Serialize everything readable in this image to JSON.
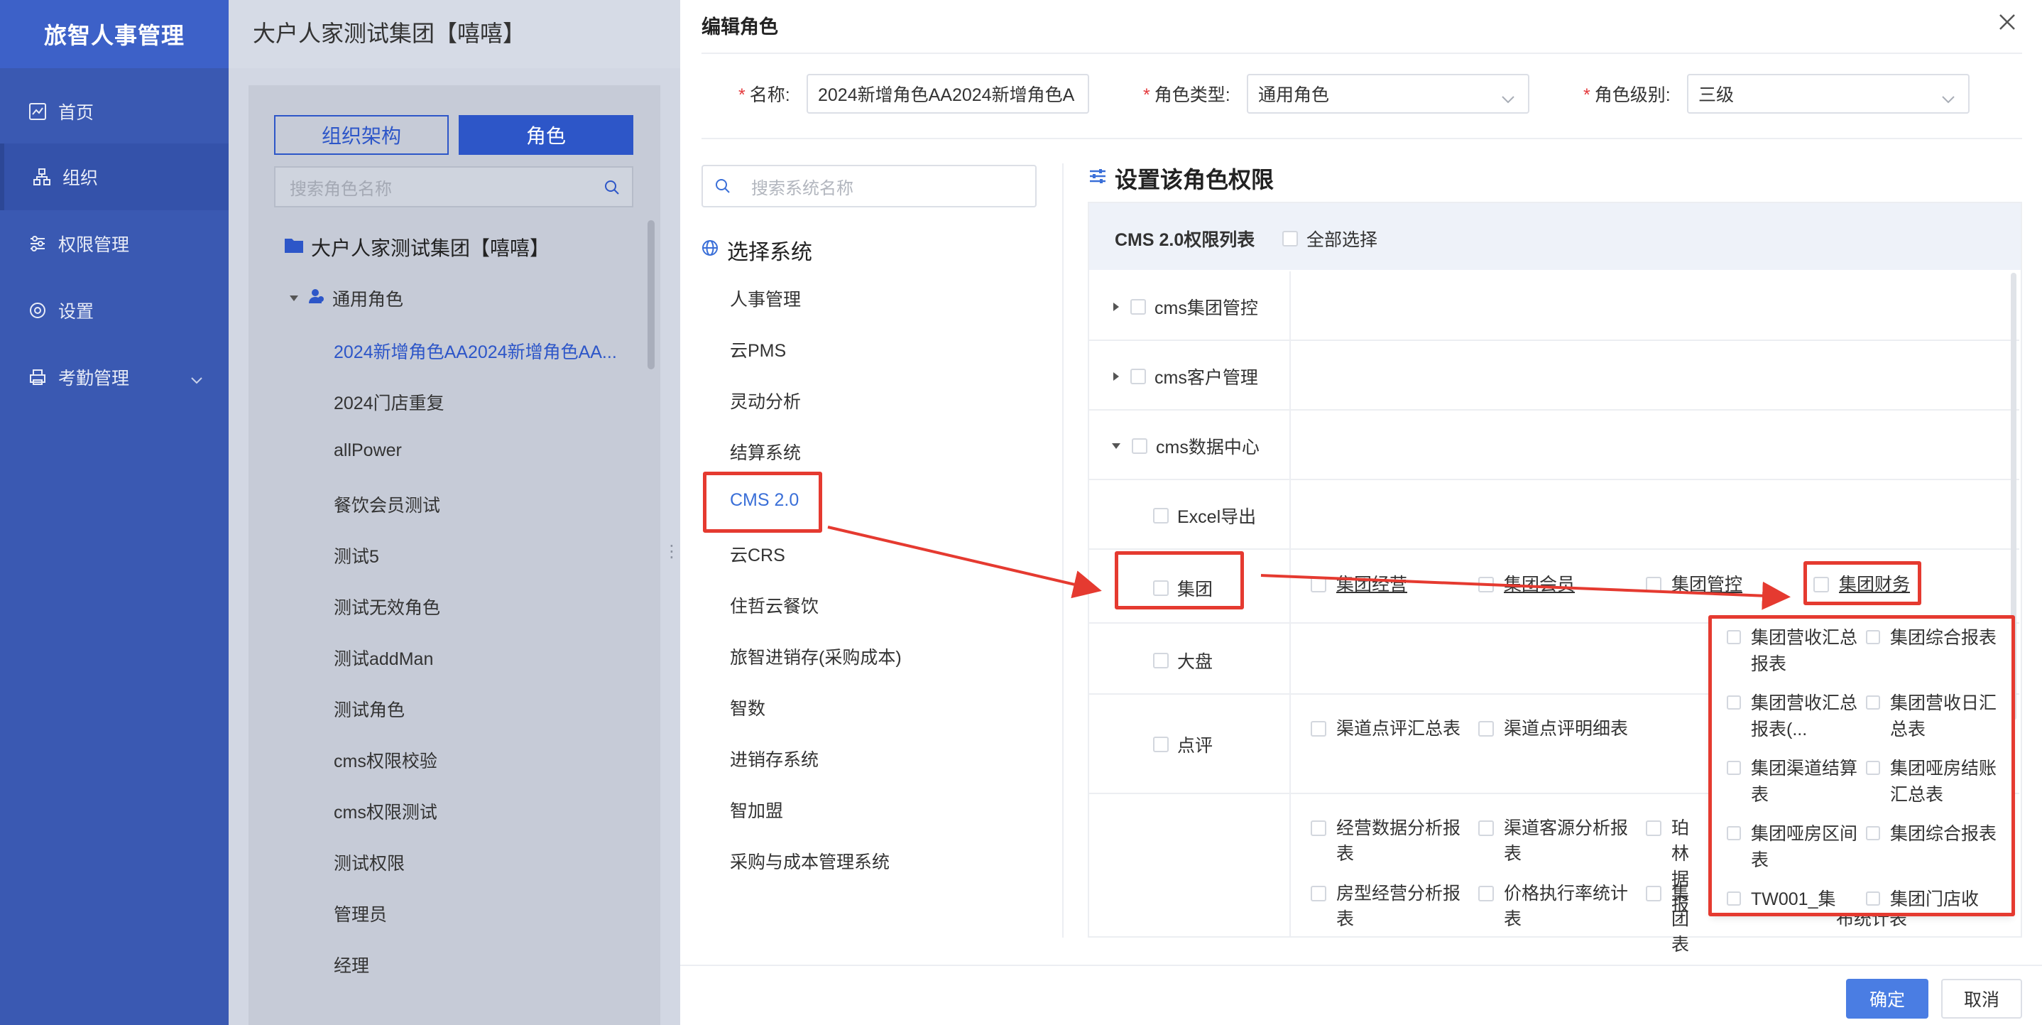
{
  "sidebar": {
    "brand": "旅智人事管理",
    "items": [
      {
        "label": "首页",
        "icon": "chart-icon"
      },
      {
        "label": "组织",
        "icon": "org-icon"
      },
      {
        "label": "权限管理",
        "icon": "sliders-icon"
      },
      {
        "label": "设置",
        "icon": "gear-icon"
      },
      {
        "label": "考勤管理",
        "icon": "printer-icon"
      }
    ]
  },
  "org": {
    "title": "大户人家测试集团【嘻嘻】",
    "tab_org": "组织架构",
    "tab_role": "角色",
    "search_placeholder": "搜索角色名称",
    "tree_root": "大户人家测试集团【嘻嘻】",
    "tree_group": "通用角色",
    "roles": [
      "2024新增角色AA2024新增角色AA...",
      "2024门店重复",
      "allPower",
      "餐饮会员测试",
      "测试5",
      "测试无效角色",
      "测试addMan",
      "测试角色",
      "cms权限校验",
      "cms权限测试",
      "测试权限",
      "管理员",
      "经理"
    ]
  },
  "modal": {
    "title": "编辑角色",
    "name_label": "名称:",
    "name_value": "2024新增角色AA2024新增角色A",
    "type_label": "角色类型:",
    "type_value": "通用角色",
    "level_label": "角色级别:",
    "level_value": "三级",
    "sys_search_placeholder": "搜索系统名称",
    "sys_heading": "选择系统",
    "systems": [
      "人事管理",
      "云PMS",
      "灵动分析",
      "结算系统",
      "CMS 2.0",
      "云CRS",
      "住哲云餐饮",
      "旅智进销存(采购成本)",
      "智数",
      "进销存系统",
      "智加盟",
      "采购与成本管理系统"
    ],
    "perm_heading": "设置该角色权限",
    "perm_list_title": "CMS 2.0权限列表",
    "select_all": "全部选择",
    "perm_rows": {
      "r1": "cms集团管控",
      "r2": "cms客户管理",
      "r3": "cms数据中心",
      "r4": "Excel导出",
      "r5": "集团",
      "r6": "大盘",
      "r7": "点评"
    },
    "group_subs": [
      "集团经营",
      "集团会员",
      "集团管控",
      "集团财务"
    ],
    "review_subs": [
      "渠道点评汇总表",
      "渠道点评明细表"
    ],
    "more_subs": [
      "经营数据分析报表",
      "渠道客源分析报表",
      "珀林据报",
      "房型经营分析报表",
      "价格执行率统计表",
      "集团表",
      "布统计表"
    ],
    "dropdown": [
      "集团营收汇总报表",
      "集团综合报表",
      "集团营收汇总报表(...",
      "集团营收日汇总表",
      "集团渠道结算表",
      "集团哑房结账汇总表",
      "集团哑房区间表",
      "集团综合报表",
      "TW001_集",
      "集团门店收"
    ],
    "ok": "确定",
    "cancel": "取消"
  },
  "colors": {
    "accent": "#3a6fd8",
    "sidebar": "#3a59b2",
    "highlight": "#e53a30"
  }
}
